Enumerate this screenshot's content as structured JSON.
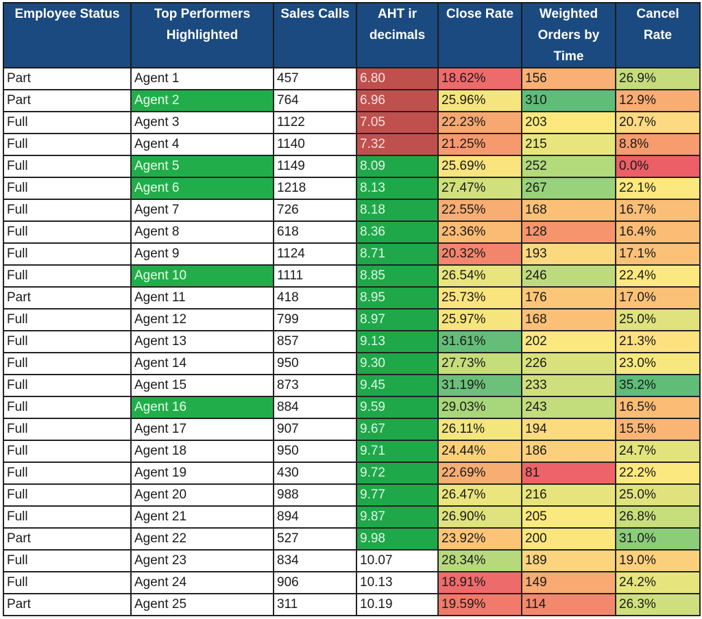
{
  "table": {
    "headers": [
      "Employee Status",
      "Top Performers\nHighlighted",
      "Sales Calls",
      "AHT ir\ndecimals",
      "Close Rate",
      "Weighted\nOrders by\nTime",
      "Cancel\nRate"
    ],
    "colors": {
      "header_bg": "#1a4a80",
      "top_performer_green": "#22ad4b",
      "aht_fast_red": "#c0504d",
      "aht_target_green": "#1fa84a"
    },
    "rows": [
      {
        "status": "Part",
        "agent": "Agent 1",
        "top": false,
        "calls": "457",
        "aht": "6.80",
        "aht_flag": "red",
        "close": "18.62%",
        "close_bg": "#ee6b6b",
        "orders": "156",
        "orders_bg": "#f8b074",
        "cancel": "26.9%",
        "cancel_bg": "#c6dc7c"
      },
      {
        "status": "Part",
        "agent": "Agent 2",
        "top": true,
        "calls": "764",
        "aht": "6.96",
        "aht_flag": "red",
        "close": "25.96%",
        "close_bg": "#f6e57c",
        "orders": "310",
        "orders_bg": "#5fbd78",
        "cancel": "12.9%",
        "cancel_bg": "#f8ad72"
      },
      {
        "status": "Full",
        "agent": "Agent 3",
        "top": false,
        "calls": "1122",
        "aht": "7.05",
        "aht_flag": "red",
        "close": "22.23%",
        "close_bg": "#f7a870",
        "orders": "203",
        "orders_bg": "#fbe97e",
        "cancel": "20.7%",
        "cancel_bg": "#fdd981"
      },
      {
        "status": "Full",
        "agent": "Agent 4",
        "top": false,
        "calls": "1140",
        "aht": "7.32",
        "aht_flag": "red",
        "close": "21.25%",
        "close_bg": "#f7996e",
        "orders": "215",
        "orders_bg": "#e9e57d",
        "cancel": "8.8%",
        "cancel_bg": "#f69c6e"
      },
      {
        "status": "Full",
        "agent": "Agent 5",
        "top": true,
        "calls": "1149",
        "aht": "8.09",
        "aht_flag": "green",
        "close": "25.69%",
        "close_bg": "#f9e47e",
        "orders": "252",
        "orders_bg": "#b3da7b",
        "cancel": "0.0%",
        "cancel_bg": "#ec5f67"
      },
      {
        "status": "Full",
        "agent": "Agent 6",
        "top": true,
        "calls": "1218",
        "aht": "8.13",
        "aht_flag": "green",
        "close": "27.47%",
        "close_bg": "#cfe07d",
        "orders": "267",
        "orders_bg": "#98d27a",
        "cancel": "22.1%",
        "cancel_bg": "#fbe87e"
      },
      {
        "status": "Full",
        "agent": "Agent 7",
        "top": false,
        "calls": "726",
        "aht": "8.18",
        "aht_flag": "green",
        "close": "22.55%",
        "close_bg": "#f8ad72",
        "orders": "168",
        "orders_bg": "#fbc076",
        "cancel": "16.7%",
        "cancel_bg": "#fbbe77"
      },
      {
        "status": "Full",
        "agent": "Agent 8",
        "top": false,
        "calls": "618",
        "aht": "8.36",
        "aht_flag": "green",
        "close": "23.36%",
        "close_bg": "#fabb75",
        "orders": "128",
        "orders_bg": "#f6956d",
        "cancel": "16.4%",
        "cancel_bg": "#fbbc76"
      },
      {
        "status": "Full",
        "agent": "Agent 9",
        "top": false,
        "calls": "1124",
        "aht": "8.71",
        "aht_flag": "green",
        "close": "20.32%",
        "close_bg": "#f3856c",
        "orders": "193",
        "orders_bg": "#fcd97e",
        "cancel": "17.1%",
        "cancel_bg": "#fbc177"
      },
      {
        "status": "Full",
        "agent": "Agent 10",
        "top": true,
        "calls": "1111",
        "aht": "8.85",
        "aht_flag": "green",
        "close": "26.54%",
        "close_bg": "#e8e57d",
        "orders": "246",
        "orders_bg": "#bedb7c",
        "cancel": "22.4%",
        "cancel_bg": "#fbe87e"
      },
      {
        "status": "Part",
        "agent": "Agent 11",
        "top": false,
        "calls": "418",
        "aht": "8.95",
        "aht_flag": "green",
        "close": "25.73%",
        "close_bg": "#f9e47e",
        "orders": "176",
        "orders_bg": "#fcc678",
        "cancel": "17.0%",
        "cancel_bg": "#fbc177"
      },
      {
        "status": "Full",
        "agent": "Agent 12",
        "top": false,
        "calls": "799",
        "aht": "8.97",
        "aht_flag": "green",
        "close": "25.97%",
        "close_bg": "#f6e57c",
        "orders": "168",
        "orders_bg": "#fbc076",
        "cancel": "25.0%",
        "cancel_bg": "#dfe27d"
      },
      {
        "status": "Full",
        "agent": "Agent 13",
        "top": false,
        "calls": "857",
        "aht": "9.13",
        "aht_flag": "green",
        "close": "31.61%",
        "close_bg": "#64be78",
        "orders": "202",
        "orders_bg": "#fbe87e",
        "cancel": "21.3%",
        "cancel_bg": "#fde17f"
      },
      {
        "status": "Full",
        "agent": "Agent 14",
        "top": false,
        "calls": "950",
        "aht": "9.30",
        "aht_flag": "green",
        "close": "27.73%",
        "close_bg": "#c6dd7c",
        "orders": "226",
        "orders_bg": "#d9e17d",
        "cancel": "23.0%",
        "cancel_bg": "#f6e87e"
      },
      {
        "status": "Full",
        "agent": "Agent 15",
        "top": false,
        "calls": "873",
        "aht": "9.45",
        "aht_flag": "green",
        "close": "31.19%",
        "close_bg": "#6cc079",
        "orders": "233",
        "orders_bg": "#cfdf7d",
        "cancel": "35.2%",
        "cancel_bg": "#5fbd78"
      },
      {
        "status": "Full",
        "agent": "Agent 16",
        "top": true,
        "calls": "884",
        "aht": "9.59",
        "aht_flag": "green",
        "close": "29.03%",
        "close_bg": "#a8d67b",
        "orders": "243",
        "orders_bg": "#c3dc7c",
        "cancel": "16.5%",
        "cancel_bg": "#fbbc76"
      },
      {
        "status": "Full",
        "agent": "Agent 17",
        "top": false,
        "calls": "907",
        "aht": "9.67",
        "aht_flag": "green",
        "close": "26.11%",
        "close_bg": "#f3e67d",
        "orders": "194",
        "orders_bg": "#fcdb7e",
        "cancel": "15.5%",
        "cancel_bg": "#fab574"
      },
      {
        "status": "Full",
        "agent": "Agent 18",
        "top": false,
        "calls": "950",
        "aht": "9.71",
        "aht_flag": "green",
        "close": "24.44%",
        "close_bg": "#fcd07b",
        "orders": "186",
        "orders_bg": "#fcd07b",
        "cancel": "24.7%",
        "cancel_bg": "#e3e37d"
      },
      {
        "status": "Full",
        "agent": "Agent 19",
        "top": false,
        "calls": "430",
        "aht": "9.72",
        "aht_flag": "green",
        "close": "22.69%",
        "close_bg": "#f8ae72",
        "orders": "81",
        "orders_bg": "#ee6369",
        "cancel": "22.2%",
        "cancel_bg": "#fbe87e"
      },
      {
        "status": "Full",
        "agent": "Agent 20",
        "top": false,
        "calls": "988",
        "aht": "9.77",
        "aht_flag": "green",
        "close": "26.47%",
        "close_bg": "#ebe57d",
        "orders": "216",
        "orders_bg": "#e8e47d",
        "cancel": "25.0%",
        "cancel_bg": "#dfe27d"
      },
      {
        "status": "Full",
        "agent": "Agent 21",
        "top": false,
        "calls": "894",
        "aht": "9.87",
        "aht_flag": "green",
        "close": "26.90%",
        "close_bg": "#dfe27d",
        "orders": "205",
        "orders_bg": "#f9e97e",
        "cancel": "26.8%",
        "cancel_bg": "#c8dd7c"
      },
      {
        "status": "Part",
        "agent": "Agent 22",
        "top": false,
        "calls": "527",
        "aht": "9.98",
        "aht_flag": "green",
        "close": "23.92%",
        "close_bg": "#fbc477",
        "orders": "200",
        "orders_bg": "#fbe67e",
        "cancel": "31.0%",
        "cancel_bg": "#8ccd7a"
      },
      {
        "status": "Full",
        "agent": "Agent 23",
        "top": false,
        "calls": "834",
        "aht": "10.07",
        "aht_flag": "none",
        "close": "28.34%",
        "close_bg": "#b7d97c",
        "orders": "189",
        "orders_bg": "#fcd47d",
        "cancel": "19.0%",
        "cancel_bg": "#fcd07b"
      },
      {
        "status": "Full",
        "agent": "Agent 24",
        "top": false,
        "calls": "906",
        "aht": "10.13",
        "aht_flag": "none",
        "close": "18.91%",
        "close_bg": "#ee6b6b",
        "orders": "149",
        "orders_bg": "#f8aa72",
        "cancel": "24.2%",
        "cancel_bg": "#e6e47d"
      },
      {
        "status": "Part",
        "agent": "Agent 25",
        "top": false,
        "calls": "311",
        "aht": "10.19",
        "aht_flag": "none",
        "close": "19.59%",
        "close_bg": "#f17a6b",
        "orders": "114",
        "orders_bg": "#f4886c",
        "cancel": "26.3%",
        "cancel_bg": "#cfdf7d"
      }
    ]
  }
}
